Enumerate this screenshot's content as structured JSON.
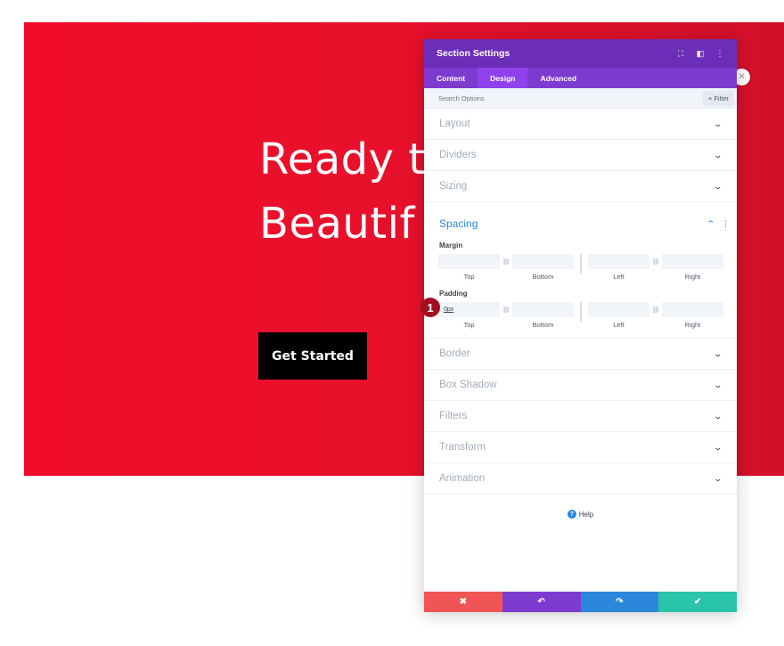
{
  "hero": {
    "title": "Ready t\nBeautif",
    "button_label": "Get Started"
  },
  "side_close_icon": "close-icon",
  "panel": {
    "title": "Section Settings",
    "icons": [
      "expand-icon",
      "sidebar-toggle-icon",
      "more-options-icon"
    ],
    "tabs": [
      {
        "label": "Content",
        "active": false
      },
      {
        "label": "Design",
        "active": true
      },
      {
        "label": "Advanced",
        "active": false
      }
    ],
    "search": {
      "placeholder": "Search Options",
      "filter_label": "+ Filter"
    },
    "groups_before": [
      {
        "label": "Layout"
      },
      {
        "label": "Dividers"
      },
      {
        "label": "Sizing"
      }
    ],
    "spacing": {
      "label": "Spacing",
      "margin_label": "Margin",
      "padding_label": "Padding",
      "captions": [
        "Top",
        "Bottom",
        "Left",
        "Right"
      ],
      "margin_values": [
        "",
        "",
        "",
        ""
      ],
      "padding_values": [
        "0px",
        "",
        "",
        ""
      ]
    },
    "groups_after": [
      {
        "label": "Border"
      },
      {
        "label": "Box Shadow"
      },
      {
        "label": "Filters"
      },
      {
        "label": "Transform"
      },
      {
        "label": "Animation"
      }
    ],
    "help_label": "Help",
    "footer": [
      {
        "name": "discard",
        "icon": "✖",
        "color": "#ef5555"
      },
      {
        "name": "undo",
        "icon": "↶",
        "color": "#7e3bd0"
      },
      {
        "name": "redo",
        "icon": "↷",
        "color": "#2b87da"
      },
      {
        "name": "save",
        "icon": "✔",
        "color": "#29c4a9"
      }
    ]
  },
  "step_badge": "1",
  "colors": {
    "hero_red": "#e8102b",
    "panel_purple": "#6c2eb9",
    "tab_purple": "#7e3bd0",
    "accent_blue": "#2b87da"
  }
}
